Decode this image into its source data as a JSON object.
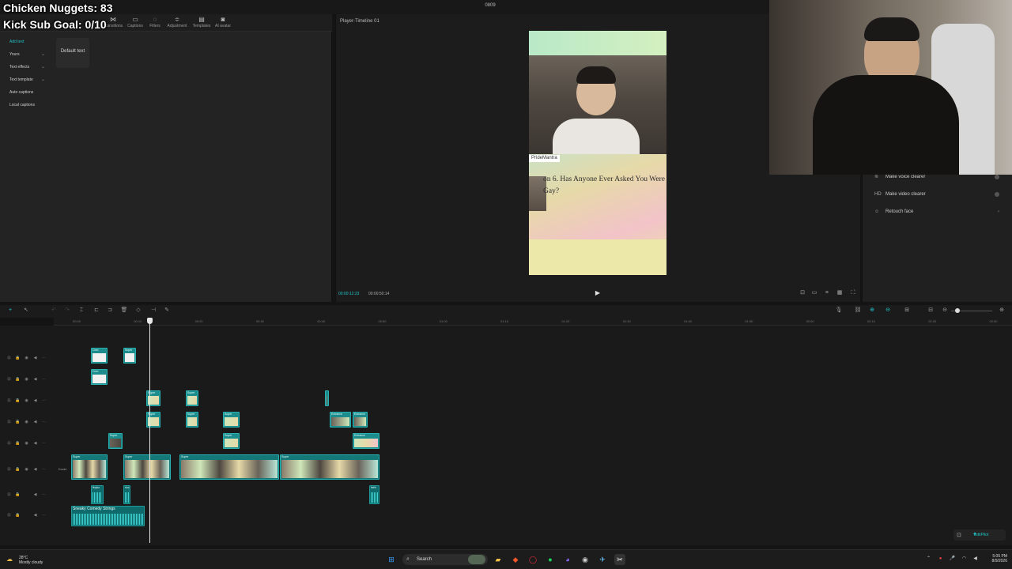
{
  "app": {
    "title": "0809"
  },
  "overlay": {
    "line1": "Chicken Nuggets: 83",
    "line2": "Kick Sub Goal: 0/10"
  },
  "toolbar": {
    "items": [
      {
        "label": "Transitions",
        "icon": "transition-icon"
      },
      {
        "label": "Captions",
        "icon": "captions-icon"
      },
      {
        "label": "Filters",
        "icon": "filter-icon"
      },
      {
        "label": "Adjustment",
        "icon": "adjustment-icon"
      },
      {
        "label": "Templates",
        "icon": "templates-icon"
      },
      {
        "label": "AI avatar",
        "icon": "avatar-icon"
      }
    ]
  },
  "sidebar": {
    "items": [
      {
        "label": "Add text",
        "active": true,
        "chevron": false
      },
      {
        "label": "Yours",
        "active": false,
        "chevron": true
      },
      {
        "label": "Text effects",
        "active": false,
        "chevron": true
      },
      {
        "label": "Text template",
        "active": false,
        "chevron": true
      },
      {
        "label": "Auto captions",
        "active": false,
        "chevron": false
      },
      {
        "label": "Local captions",
        "active": false,
        "chevron": false
      }
    ]
  },
  "text_panel": {
    "default_text": "Default text"
  },
  "player": {
    "title": "Player-Timeline 01",
    "current_time": "00:00:12:23",
    "total_time": "00:00:50:14",
    "preview": {
      "tag": "PrideMantra",
      "question": "on 6. Has Anyone Ever Asked You Were Gay?"
    }
  },
  "right_panel": {
    "items": [
      {
        "label": "Make voice clearer",
        "prefix": "≋"
      },
      {
        "label": "Make video clearer",
        "prefix": "HD"
      },
      {
        "label": "Retouch face",
        "prefix": "☺"
      }
    ]
  },
  "timeline": {
    "ruler_ticks": [
      "00:00",
      "00:10",
      "00:20",
      "00:30",
      "00:40",
      "00:50",
      "01:00",
      "01:10",
      "01:20",
      "01:30",
      "01:40",
      "01:50",
      "02:00",
      "02:10",
      "02:20",
      "02:30"
    ],
    "cover_label": "Cover",
    "clip_labels": {
      "text1": "Com",
      "text2": "Super",
      "fx": "Super",
      "enhance": "Enhance",
      "main": "Super",
      "audio1": "lloybo",
      "audio2": "shc",
      "audio3": "fabh",
      "music": "Sneaky Comedy Strings"
    }
  },
  "editpilot": {
    "label": "EditPilot"
  },
  "taskbar": {
    "weather_temp": "28°C",
    "weather_desc": "Mostly cloudy",
    "search_placeholder": "Search",
    "time": "5:05 PM",
    "date": "8/9/2026"
  },
  "colors": {
    "accent": "#20c3c6",
    "clip": "#1c8c8c",
    "background": "#1a1a1a"
  }
}
